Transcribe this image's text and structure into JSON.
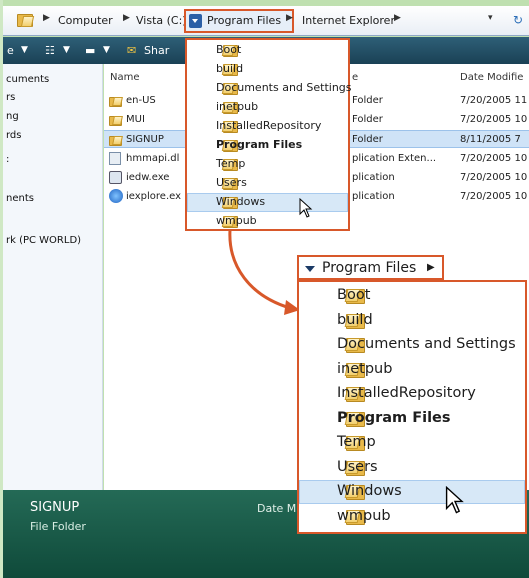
{
  "address_bar": {
    "crumbs": [
      "Computer",
      "Vista (C:)",
      "Program Files",
      "Internet Explorer"
    ],
    "refresh_glyph": "→",
    "dropdown_glyph": "▾"
  },
  "toolbar": {
    "organize_label": "e",
    "views_label": "",
    "share_label": "Shar"
  },
  "nav": {
    "items": [
      "cuments",
      "rs",
      "ng",
      "rds",
      ":",
      "nents",
      "rk (PC WORLD)"
    ]
  },
  "files": {
    "col_name": "Name",
    "col_type": "e",
    "col_date": "Date Modifie",
    "rows": [
      {
        "name": "en-US",
        "type": "Folder",
        "date": "7/20/2005 11",
        "icon": "folder-icon"
      },
      {
        "name": "MUI",
        "type": "Folder",
        "date": "7/20/2005 10",
        "icon": "folder-icon"
      },
      {
        "name": "SIGNUP",
        "type": "Folder",
        "date": "8/11/2005 7",
        "icon": "folder-icon"
      },
      {
        "name": "hmmapi.dl",
        "type": "plication Exten...",
        "date": "7/20/2005 10",
        "icon": "dll-file-icon"
      },
      {
        "name": "iedw.exe",
        "type": "plication",
        "date": "7/20/2005 10",
        "icon": "exe-file-icon"
      },
      {
        "name": "iexplore.ex",
        "type": "plication",
        "date": "7/20/2005 10",
        "icon": "ie-file-icon"
      }
    ]
  },
  "details": {
    "name": "SIGNUP",
    "kind": "File Folder",
    "date_label": "Date M"
  },
  "menu_small": {
    "items": [
      "Boot",
      "build",
      "Documents and Settings",
      "inetpub",
      "InstalledRepository",
      "Program Files",
      "Temp",
      "Users",
      "Windows",
      "wmpub"
    ]
  },
  "menu_zoom": {
    "header": "Program Files",
    "items": [
      "Boot",
      "build",
      "Documents and Settings",
      "inetpub",
      "InstalledRepository",
      "Program Files",
      "Temp",
      "Users",
      "Windows",
      "wmpub"
    ]
  },
  "colors": {
    "accent": "#d8582a",
    "hover": "#d7e8f7",
    "toolbar": "#1f4a5f",
    "details": "#135440"
  }
}
